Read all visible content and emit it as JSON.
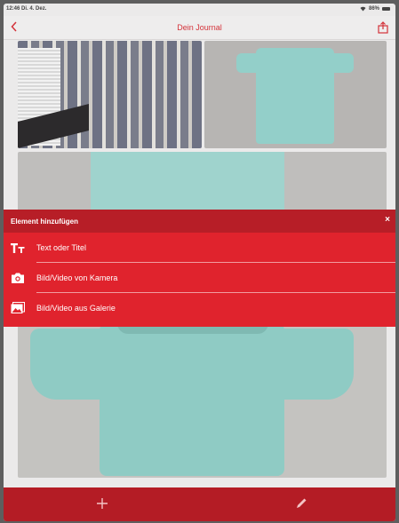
{
  "status_bar": {
    "time": "12:46",
    "date": "Di. 4. Dez.",
    "battery": "86%"
  },
  "nav": {
    "title": "Dein Journal",
    "back_icon": "chevron-left-icon",
    "share_icon": "share-icon"
  },
  "panel": {
    "title": "Element hinzufügen",
    "close": "×",
    "items": [
      {
        "label": "Text oder Titel",
        "icon": "text-format-icon"
      },
      {
        "label": "Bild/Video von Kamera",
        "icon": "camera-icon"
      },
      {
        "label": "Bild/Video aus Galerie",
        "icon": "gallery-icon"
      }
    ]
  },
  "tabbar": {
    "add_icon": "plus-icon",
    "edit_icon": "pencil-icon"
  },
  "colors": {
    "accent": "#e0232d",
    "header": "#b71e27",
    "nav_title": "#d4333a",
    "background": "#ebeaea"
  }
}
